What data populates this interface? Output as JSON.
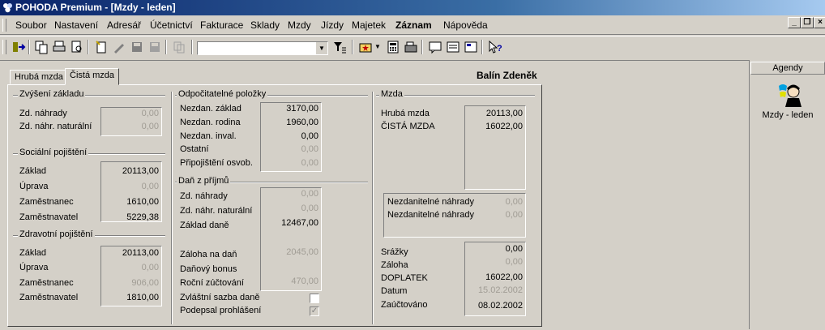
{
  "window": {
    "title": "POHODA Premium - [Mzdy - leden]"
  },
  "menu": [
    "Soubor",
    "Nastavení",
    "Adresář",
    "Účetnictví",
    "Fakturace",
    "Sklady",
    "Mzdy",
    "Jízdy",
    "Majetek",
    "Záznam",
    "Nápověda"
  ],
  "tabs": [
    "Hrubá mzda",
    "Čistá mzda"
  ],
  "employee": "Balín Zdeněk",
  "zvyseni": {
    "title": "Zvýšení základu",
    "labels": [
      "Zd. náhrady",
      "Zd. náhr. naturální"
    ],
    "values": [
      "0,00",
      "0,00"
    ]
  },
  "socialni": {
    "title": "Sociální pojištění",
    "labels": [
      "Základ",
      "Úprava",
      "Zaměstnanec",
      "Zaměstnavatel"
    ],
    "values": [
      "20113,00",
      "0,00",
      "1610,00",
      "5229,38"
    ]
  },
  "zdravotni": {
    "title": "Zdravotní pojištění",
    "labels": [
      "Základ",
      "Úprava",
      "Zaměstnanec",
      "Zaměstnavatel"
    ],
    "values": [
      "20113,00",
      "0,00",
      "906,00",
      "1810,00"
    ]
  },
  "odpocitatelne": {
    "title": "Odpočitatelné položky",
    "labels": [
      "Nezdan. základ",
      "Nezdan. rodina",
      "Nezdan. inval.",
      "Ostatní",
      "Připojištění osvob."
    ],
    "values": [
      "3170,00",
      "1960,00",
      "0,00",
      "0,00",
      "0,00"
    ]
  },
  "dan": {
    "title": "Daň z příjmů",
    "labels": [
      "Zd. náhrady",
      "Zd. náhr. naturální",
      "Základ daně",
      "Záloha na daň",
      "Daňový bonus",
      "Roční zúčtování",
      "Zvláštní sazba daně",
      "Podepsal prohlášení"
    ],
    "values": [
      "0,00",
      "0,00",
      "12467,00",
      "2045,00",
      "",
      "470,00"
    ]
  },
  "mzda": {
    "title": "Mzda",
    "labels": [
      "Hrubá mzda",
      "ČISTÁ MZDA"
    ],
    "values": [
      "20113,00",
      "16022,00"
    ]
  },
  "nezdanitelne": {
    "labels": [
      "Nezdanitelné náhrady",
      "Nezdanitelné náhrady"
    ],
    "values": [
      "0,00",
      "0,00"
    ]
  },
  "srazky": {
    "labels": [
      "Srážky",
      "Záloha",
      "DOPLATEK",
      "Datum",
      "Zaúčtováno"
    ],
    "values": [
      "0,00",
      "0,00",
      "16022,00",
      "15.02.2002",
      "08.02.2002"
    ]
  },
  "agendy": {
    "title": "Agendy",
    "item": "Mzdy - leden"
  },
  "colors": {
    "titlebar": "#0a246a",
    "face": "#d4d0c8",
    "disabled": "#a09c94"
  }
}
